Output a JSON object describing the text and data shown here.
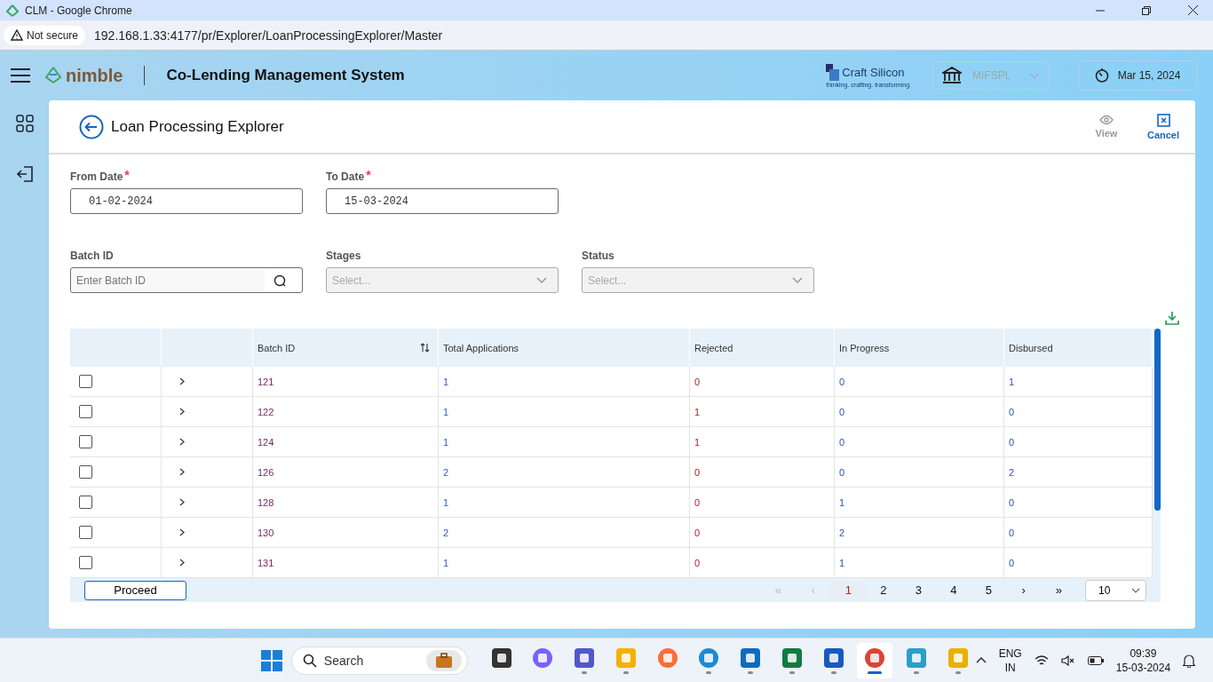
{
  "browser": {
    "title": "CLM - Google Chrome",
    "security": "Not secure",
    "url": "192.168.1.33:4177/pr/Explorer/LoanProcessingExplorer/Master"
  },
  "header": {
    "logo": "nimble",
    "system": "Co-Lending Management System",
    "company": "Craft Silicon",
    "tagline": "thinking. crafting. transforming.",
    "branch": {
      "value": "MIFSPL",
      "disabled": true
    },
    "date": "Mar 15, 2024"
  },
  "page": {
    "title": "Loan Processing Explorer",
    "actions": [
      {
        "label": "View",
        "disabled": true,
        "kind": "view"
      },
      {
        "label": "Cancel",
        "disabled": false,
        "kind": "cancel"
      }
    ]
  },
  "filters": [
    {
      "label": "From Date",
      "required_mark": "*",
      "kind": "date",
      "value": "01-02-2024"
    },
    {
      "label": "To Date",
      "required_mark": "*",
      "kind": "date",
      "value": "15-03-2024"
    },
    {
      "label": "Batch ID",
      "kind": "search",
      "placeholder": "Enter Batch ID"
    },
    {
      "label": "Stages",
      "kind": "select",
      "placeholder": "Select..."
    },
    {
      "label": "Status",
      "kind": "select",
      "placeholder": "Select..."
    }
  ],
  "table": {
    "columns": [
      "Batch ID",
      "Total Applications",
      "Rejected",
      "In Progress",
      "Disbursed"
    ],
    "rows": [
      {
        "checked": false,
        "cells": [
          "121",
          "1",
          "0",
          "0",
          "1"
        ]
      },
      {
        "checked": false,
        "cells": [
          "122",
          "1",
          "1",
          "0",
          "0"
        ]
      },
      {
        "checked": false,
        "cells": [
          "124",
          "1",
          "1",
          "0",
          "0"
        ]
      },
      {
        "checked": false,
        "cells": [
          "126",
          "2",
          "0",
          "0",
          "2"
        ]
      },
      {
        "checked": false,
        "cells": [
          "128",
          "1",
          "0",
          "1",
          "0"
        ]
      },
      {
        "checked": false,
        "cells": [
          "130",
          "2",
          "0",
          "2",
          "0"
        ]
      },
      {
        "checked": false,
        "cells": [
          "131",
          "1",
          "0",
          "1",
          "0"
        ]
      }
    ]
  },
  "footer": {
    "proceed": "Proceed",
    "first": {
      "label": "«",
      "disabled": true
    },
    "prev": {
      "label": "‹",
      "disabled": true
    },
    "pages": [
      {
        "label": "1",
        "selected": true
      },
      {
        "label": "2",
        "selected": false
      },
      {
        "label": "3",
        "selected": false
      },
      {
        "label": "4",
        "selected": false
      },
      {
        "label": "5",
        "selected": false
      }
    ],
    "next": {
      "label": "›",
      "disabled": false
    },
    "last": {
      "label": "»",
      "disabled": false
    },
    "page_size": "10"
  },
  "taskbar": {
    "search": "Search",
    "apps": [
      {
        "kind": "files",
        "running": false,
        "active": false
      },
      {
        "kind": "meet",
        "running": false,
        "active": false
      },
      {
        "kind": "teams",
        "running": true,
        "active": false
      },
      {
        "kind": "folder",
        "running": true,
        "active": false
      },
      {
        "kind": "postman",
        "running": false,
        "active": false
      },
      {
        "kind": "edge",
        "running": true,
        "active": false
      },
      {
        "kind": "outlook",
        "running": true,
        "active": false
      },
      {
        "kind": "excel",
        "running": true,
        "active": false
      },
      {
        "kind": "word",
        "running": true,
        "active": false
      },
      {
        "kind": "chrome",
        "running": true,
        "active": true
      },
      {
        "kind": "notepad",
        "running": true,
        "active": false
      },
      {
        "kind": "tool",
        "running": true,
        "active": false
      }
    ],
    "lang": "ENG",
    "region": "IN",
    "time": "09:39",
    "date": "15-03-2024"
  }
}
